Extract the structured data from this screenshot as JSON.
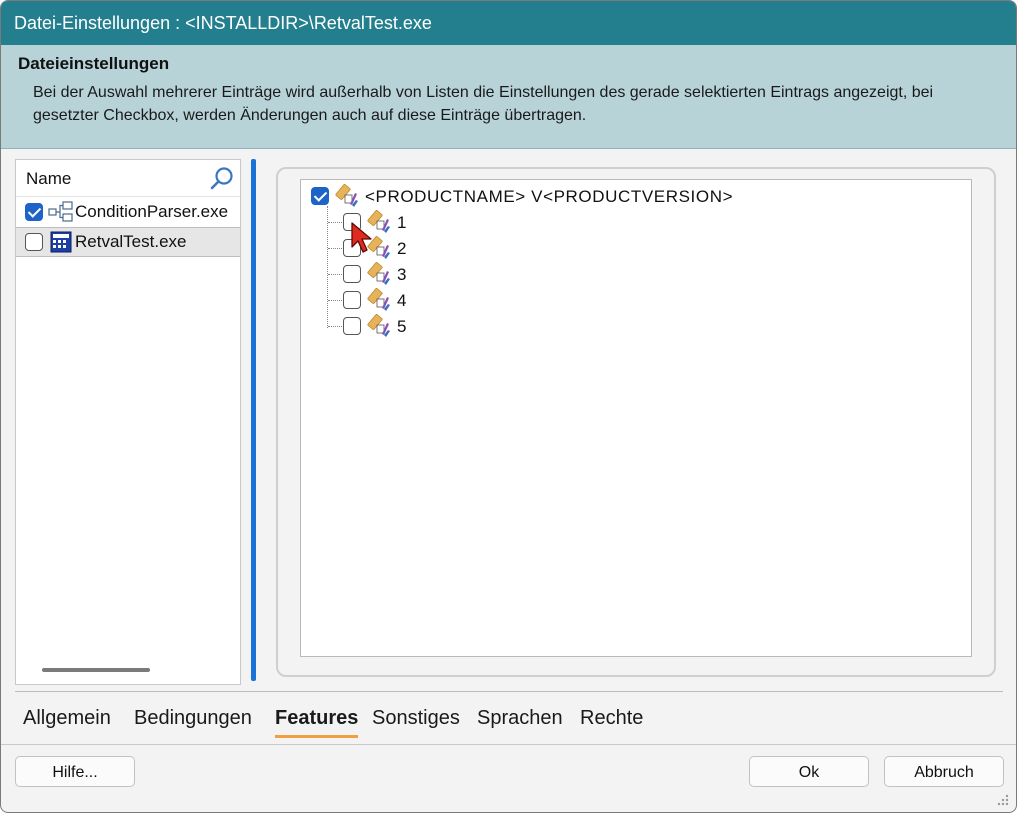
{
  "window": {
    "title": "Datei-Einstellungen : <INSTALLDIR>\\RetvalTest.exe"
  },
  "header": {
    "heading": "Dateieinstellungen",
    "description": "Bei der Auswahl mehrerer Einträge wird außerhalb von Listen die Einstellungen des gerade selektierten Eintrags angezeigt, bei gesetzter Checkbox, werden Änderungen auch auf diese Einträge übertragen."
  },
  "file_list": {
    "column_header": "Name",
    "items": [
      {
        "label": "ConditionParser.exe",
        "checked": true,
        "icon": "component-tree-icon"
      },
      {
        "label": "RetvalTest.exe",
        "checked": false,
        "selected": true,
        "icon": "exe-file-icon"
      }
    ]
  },
  "feature_tree": {
    "root": {
      "label": "<PRODUCTNAME> V<PRODUCTVERSION>",
      "checked": true
    },
    "children": [
      {
        "label": "1",
        "checked": false
      },
      {
        "label": "2",
        "checked": false
      },
      {
        "label": "3",
        "checked": false
      },
      {
        "label": "4",
        "checked": false
      },
      {
        "label": "5",
        "checked": false
      }
    ]
  },
  "tabs": [
    {
      "label": "Allgemein",
      "active": false
    },
    {
      "label": "Bedingungen",
      "active": false
    },
    {
      "label": "Features",
      "active": true
    },
    {
      "label": "Sonstiges",
      "active": false
    },
    {
      "label": "Sprachen",
      "active": false
    },
    {
      "label": "Rechte",
      "active": false
    }
  ],
  "buttons": {
    "help": "Hilfe...",
    "ok": "Ok",
    "cancel": "Abbruch"
  },
  "colors": {
    "titlebar": "#237f8e",
    "header": "#b7d3d8",
    "accent": "#1e64c8",
    "tab_underline": "#f0a040"
  }
}
